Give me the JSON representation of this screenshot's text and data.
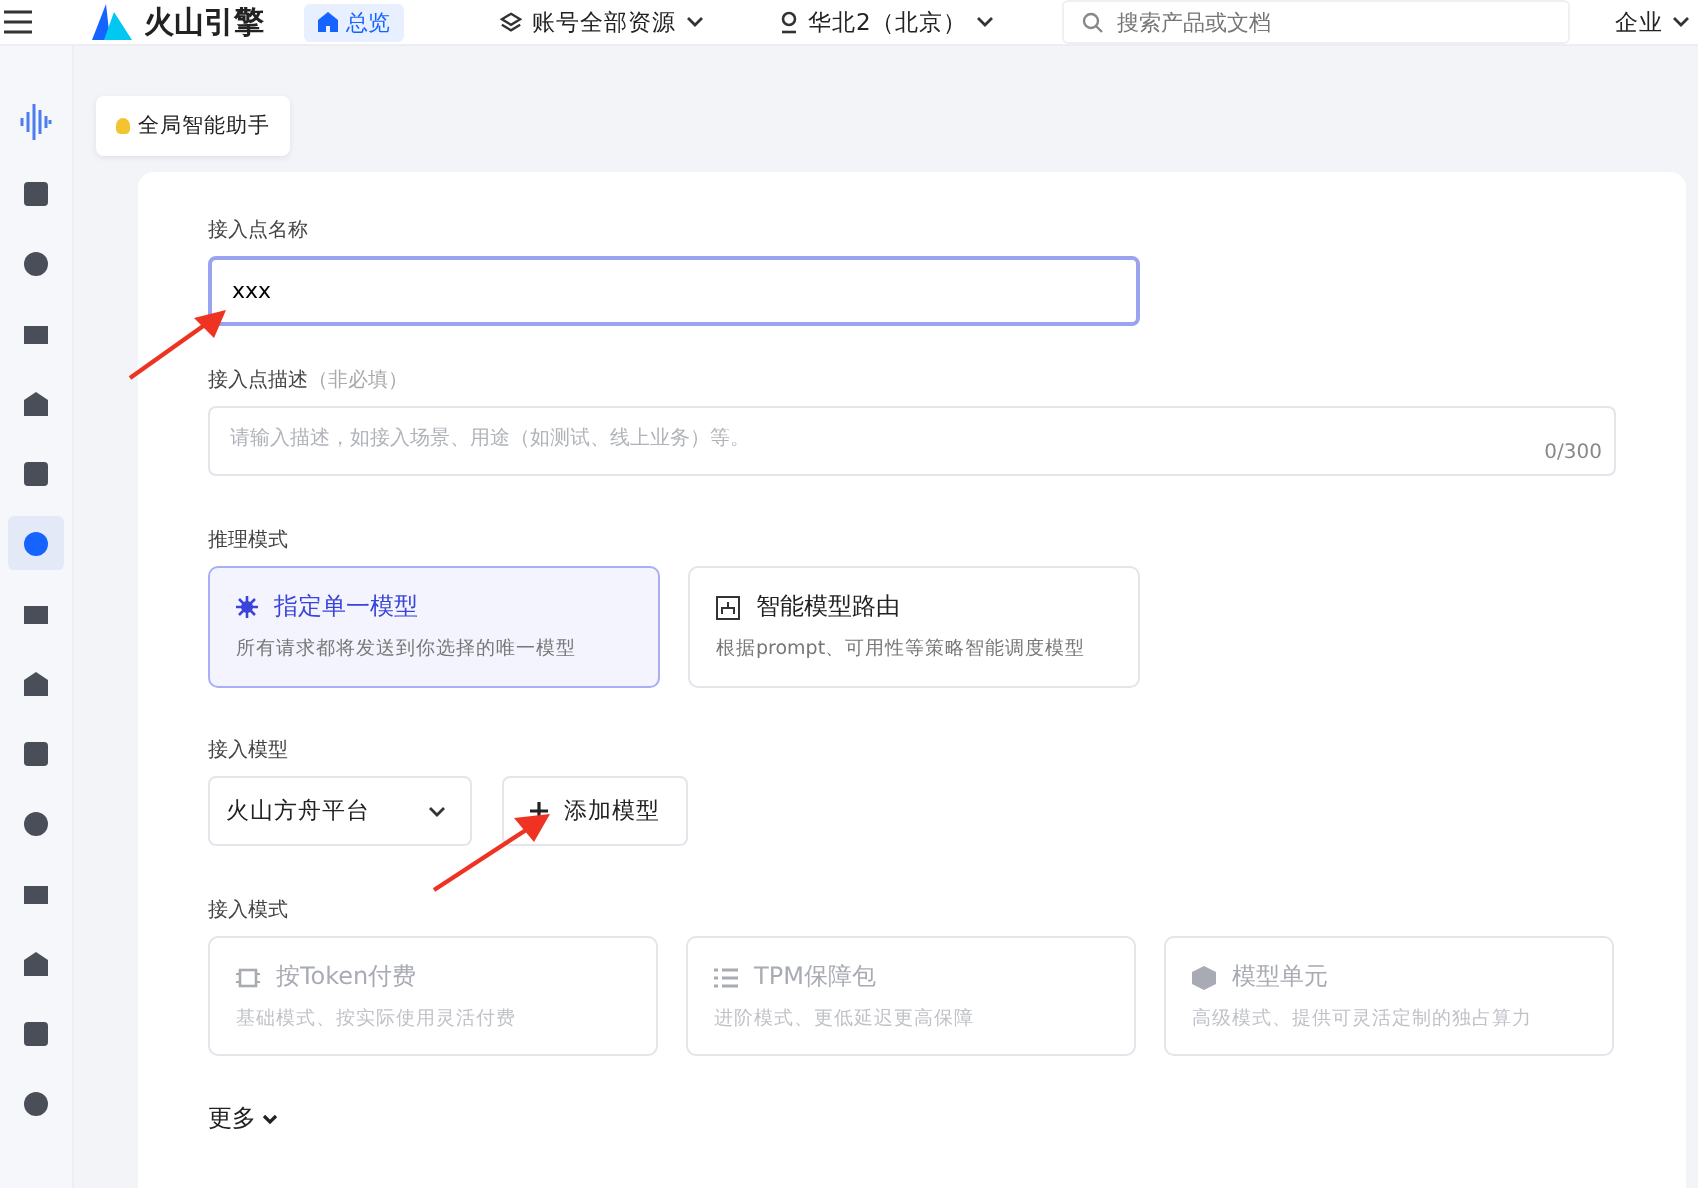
{
  "topbar": {
    "brand": "火山引擎",
    "home_tab": {
      "label": "总览",
      "selected": true
    },
    "account_menu": "账号全部资源",
    "region_menu": "华北2（北京）",
    "search": {
      "placeholder": "搜索产品或文档"
    },
    "org_menu": "企业"
  },
  "assistant": {
    "label": "全局智能助手"
  },
  "sidebar": {
    "items": [
      {
        "selected": false
      },
      {
        "selected": false
      },
      {
        "selected": false
      },
      {
        "selected": false
      },
      {
        "selected": false
      },
      {
        "selected": true
      },
      {
        "selected": false
      },
      {
        "selected": false
      },
      {
        "selected": false
      },
      {
        "selected": false
      },
      {
        "selected": false
      },
      {
        "selected": false
      },
      {
        "selected": false
      },
      {
        "selected": false
      }
    ]
  },
  "form": {
    "name_label": "接入点名称",
    "name_value": "xxx",
    "desc_label": "接入点描述",
    "desc_hint": "（非必填）",
    "desc_placeholder": "请输入描述，如接入场景、用途（如测试、线上业务）等。",
    "desc_counter": "0/300",
    "inference_label": "推理模式",
    "inference_modes": [
      {
        "title": "指定单一模型",
        "desc": "所有请求都将发送到你选择的唯一模型",
        "selected": true
      },
      {
        "title": "智能模型路由",
        "desc": "根据prompt、可用性等策略智能调度模型",
        "selected": false
      }
    ],
    "model_label": "接入模型",
    "model_select": "火山方舟平台",
    "add_model": "添加模型",
    "access_label": "接入模式",
    "access_modes": [
      {
        "title": "按Token付费",
        "desc": "基础模式、按实际使用灵活付费",
        "disabled": true
      },
      {
        "title": "TPM保障包",
        "desc": "进阶模式、更低延迟更高保障",
        "disabled": true
      },
      {
        "title": "模型单元",
        "desc": "高级模式、提供可灵活定制的独占算力",
        "disabled": true
      }
    ],
    "more": "更多"
  }
}
